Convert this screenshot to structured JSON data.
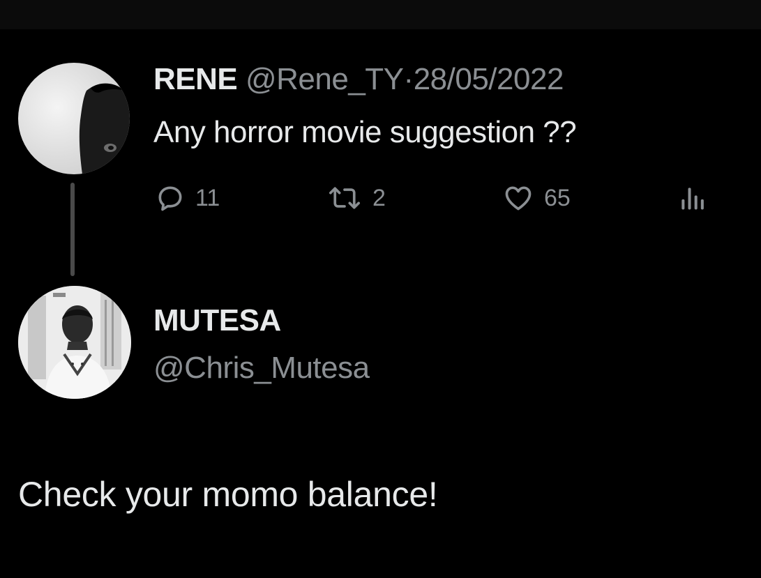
{
  "original_tweet": {
    "display_name": "RENE",
    "handle": "@Rene_TY",
    "separator": "·",
    "date": "28/05/2022",
    "text": "Any horror movie suggestion ??",
    "actions": {
      "replies": "11",
      "retweets": "2",
      "likes": "65"
    },
    "icons": [
      "reply-icon",
      "retweet-icon",
      "heart-icon",
      "views-icon"
    ]
  },
  "reply": {
    "display_name": "MUTESA",
    "handle": "@Chris_Mutesa",
    "text": "Check your momo balance!"
  },
  "colors": {
    "background": "#000000",
    "primary_text": "#e7e9ea",
    "secondary_text": "#8b8f93",
    "thread_line": "#4a4a4a"
  }
}
